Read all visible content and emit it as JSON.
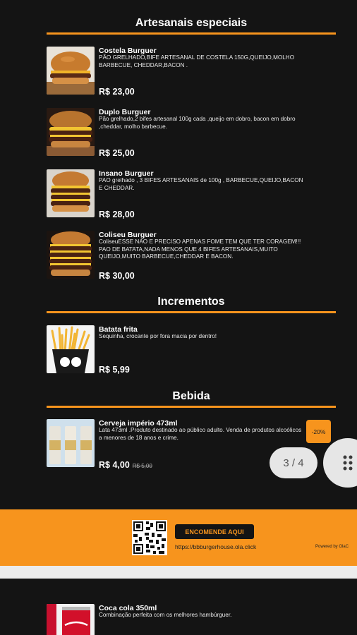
{
  "sections": {
    "especiais": "Artesanais especiais",
    "incrementos": "Incrementos",
    "bebida": "Bebida"
  },
  "products": [
    {
      "name": "Costela Burguer",
      "description": "PÃO GRELHADO,BIFE ARTESANAL DE COSTELA 150G,QUEIJO,MOLHO BARBECUE, CHEDDAR,BACON .",
      "price": "R$ 23,00",
      "image": "burger-photo"
    },
    {
      "name": "Duplo Burguer",
      "description": "Pão grelhado,2 bifes artesanal 100g cada ,queijo em dobro, bacon em dobro ,cheddar, molho barbecue.",
      "price": "R$ 25,00",
      "image": "burger-photo"
    },
    {
      "name": "Insano Burguer",
      "description": "PAO grelhado , 3 BIFES ARTESANAIS de 100g , BARBECUE,QUEIJO,BACON E CHEDDAR.",
      "price": "R$ 28,00",
      "image": "burger-photo"
    },
    {
      "name": "Coliseu Burguer",
      "description": "ColiseuESSE NAO E PRECISO APENAS FOME TEM QUE TER CORAGEM!!! PAO DE BATATA,NADA MENOS QUE 4 BIFES ARTESANAIS,MUITO QUEIJO,MUITO BARBECUE,CHEDDAR E BACON.",
      "price": "R$ 30,00",
      "image": "burger-photo"
    },
    {
      "name": "Batata frita",
      "description": "Sequinha, crocante por fora macia por dentro!",
      "price": "R$ 5,99",
      "image": "fries-photo"
    },
    {
      "name": "Cerveja império 473ml",
      "description": "Lata 473ml .Produto destinado ao público adulto. Venda de produtos alcoólicos a menores de 18 anos e crime.",
      "price": "R$ 4,00",
      "old_price": "R$ 5,00",
      "discount": "-20%",
      "image": "beer-can-photo"
    },
    {
      "name": "Coca cola 350ml",
      "description": "Combinação perfeita com os melhores hambúrguer.",
      "image": "coke-can-photo"
    }
  ],
  "pager": {
    "label": "3 / 4"
  },
  "banner": {
    "button": "ENCOMENDE AQUI",
    "url": "https://bbburgerhouse.ola.click",
    "powered": "Powered by OlaC"
  },
  "colors": {
    "background": "#141414",
    "accent": "#f7941d",
    "text": "#ffffff"
  }
}
